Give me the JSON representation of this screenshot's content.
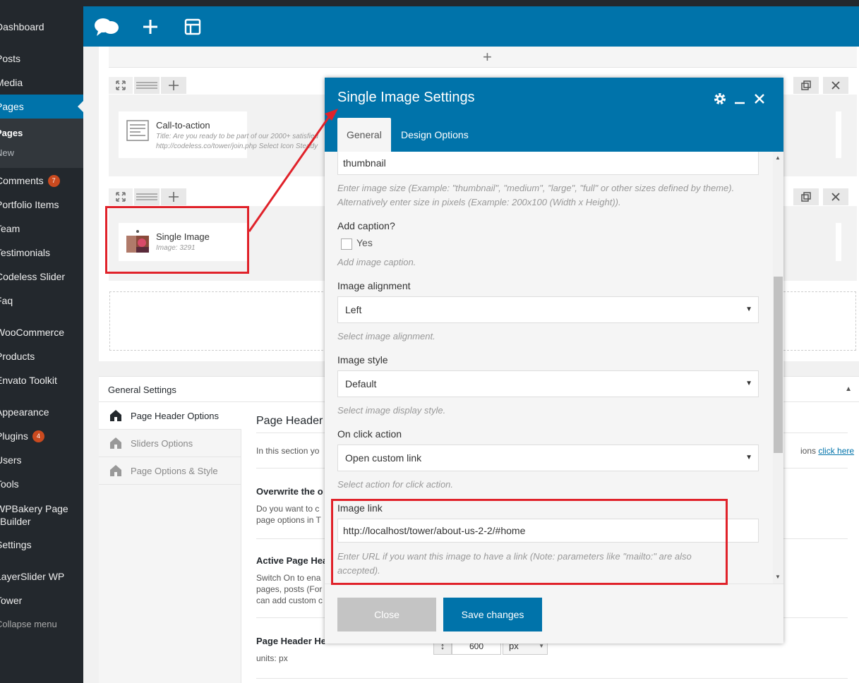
{
  "sidebar": {
    "items": [
      {
        "label": "Dashboard"
      },
      {
        "label": "Posts"
      },
      {
        "label": "Media"
      },
      {
        "label": "Pages"
      },
      {
        "label": "Comments",
        "badge": "7"
      },
      {
        "label": "Portfolio Items"
      },
      {
        "label": "Team"
      },
      {
        "label": "Testimonials"
      },
      {
        "label": "Codeless Slider"
      },
      {
        "label": "Faq"
      },
      {
        "label": "WooCommerce"
      },
      {
        "label": "Products"
      },
      {
        "label": "Envato Toolkit"
      },
      {
        "label": "Appearance"
      },
      {
        "label": "Plugins",
        "badge": "4"
      },
      {
        "label": "Users"
      },
      {
        "label": "Tools"
      },
      {
        "label": "WPBakery Page Builder"
      },
      {
        "label": "Settings"
      },
      {
        "label": "LayerSlider WP"
      },
      {
        "label": "Tower"
      },
      {
        "label": "Collapse menu"
      }
    ],
    "pages_sub": [
      "Pages",
      "New"
    ]
  },
  "canvas": {
    "rows": [
      {
        "element_title": "Call-to-action",
        "element_desc_1": "Title: Are you ready to be part of our 2000+ satisfied",
        "element_desc_2": "http://codeless.co/tower/join.php  Select Icon Steady"
      },
      {
        "element_title": "Single Image",
        "element_desc_1": "Image: 3291"
      }
    ]
  },
  "general_settings": {
    "title": "General Settings",
    "nav": [
      "Page Header Options",
      "Sliders Options",
      "Page Options & Style"
    ],
    "content": {
      "heading": "Page Header",
      "intro": "In this section yo",
      "intro_suffix": "ions",
      "intro_link": "click here",
      "overwrite_title": "Overwrite the o",
      "overwrite_text_1": "Do you want to c",
      "overwrite_text_2": "page options in T",
      "active_title": "Active Page Hea",
      "active_text_1": "Switch On to ena",
      "active_text_2": "pages, posts (For",
      "active_text_3": "can add custom c",
      "height_title": "Page Header He",
      "height_units": "units: px",
      "height_value": "600",
      "height_unit_select": "px"
    }
  },
  "modal": {
    "title": "Single Image Settings",
    "tabs": [
      "General",
      "Design Options"
    ],
    "fields": {
      "image_size_value": "thumbnail",
      "image_size_hint": "Enter image size (Example: \"thumbnail\", \"medium\", \"large\", \"full\" or other sizes defined by theme). Alternatively enter size in pixels (Example: 200x100 (Width x Height)).",
      "caption_label": "Add caption?",
      "caption_option": "Yes",
      "caption_hint": "Add image caption.",
      "alignment_label": "Image alignment",
      "alignment_value": "Left",
      "alignment_hint": "Select image alignment.",
      "style_label": "Image style",
      "style_value": "Default",
      "style_hint": "Select image display style.",
      "click_label": "On click action",
      "click_value": "Open custom link",
      "click_hint": "Select action for click action.",
      "link_label": "Image link",
      "link_value": "http://localhost/tower/about-us-2-2/#home",
      "link_hint": "Enter URL if you want this image to have a link (Note: parameters like \"mailto:\" are also accepted)."
    },
    "buttons": {
      "close": "Close",
      "save": "Save changes"
    }
  },
  "colors": {
    "wp_blue": "#0073aa",
    "sidebar_bg": "#23282d",
    "annotation_red": "#e0222a"
  }
}
